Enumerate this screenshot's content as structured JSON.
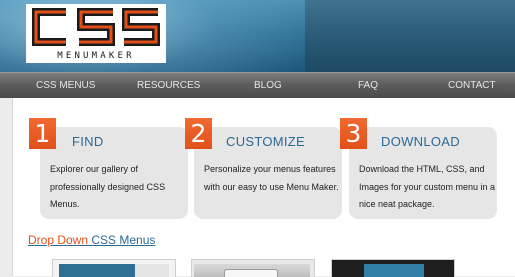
{
  "logo": {
    "letters": "CSS",
    "subtitle": "MENUMAKER",
    "accent_color": "#e2501a"
  },
  "nav": {
    "items": [
      "CSS MENUS",
      "RESOURCES",
      "BLOG",
      "FAQ",
      "CONTACT"
    ]
  },
  "steps": [
    {
      "number": "1",
      "title": "FIND",
      "body": "Explorer our gallery of professionally designed CSS Menus."
    },
    {
      "number": "2",
      "title": "CUSTOMIZE",
      "body": "Personalize your menus features with our easy to use Menu Maker."
    },
    {
      "number": "3",
      "title": "DOWNLOAD",
      "body": "Download the HTML, CSS, and Images for your custom menu in a nice neat package."
    }
  ],
  "section": {
    "highlight": "Drop Down",
    "rest": " CSS Menus"
  },
  "colors": {
    "accent": "#e2501a",
    "heading": "#2a6a95",
    "nav": "#5d5d5d",
    "header": "#2d6f95"
  }
}
